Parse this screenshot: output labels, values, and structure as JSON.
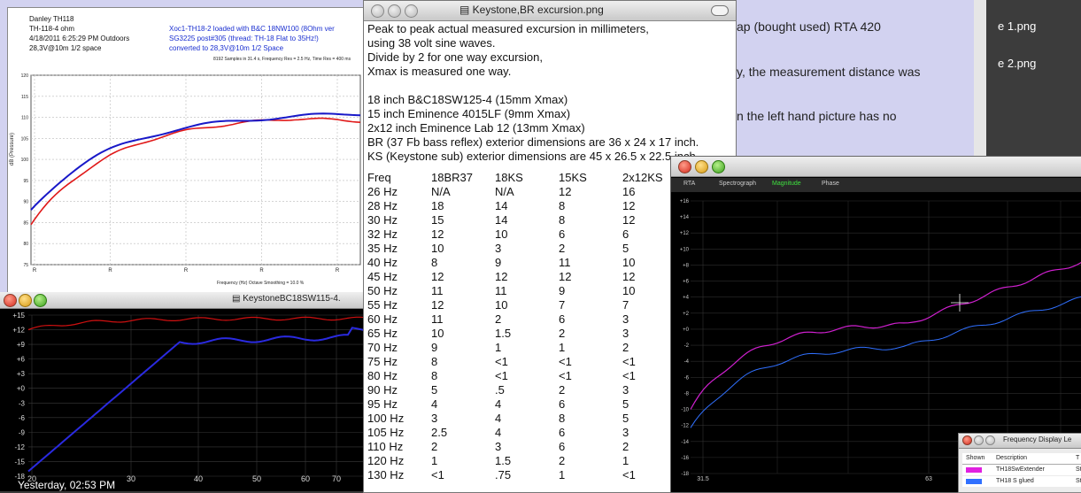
{
  "background_text": {
    "line1": "ap (bought used) RTA 420",
    "line2": "y, the measurement distance was",
    "line3": "n the left hand picture has no",
    "thumb1": "e 1.png",
    "thumb2": "e 2.png",
    "finder_date": "Yesterday, 02:53 PM"
  },
  "chart1": {
    "h_name": "Danley TH118",
    "h_model": "TH-118-4 ohm",
    "h_date": "4/18/2011 6:25:29 PM   Outdoors",
    "h_level": "28,3V@10m 1/2 space",
    "h_b1": "Xoc1-TH18-2 loaded with B&C 18NW100 (8Ohm ver",
    "h_b2": "SG3225 post#305 (thread: TH-18 Flat to 35Hz!)",
    "h_b3": "converted to 28,3V@10m  1/2 Space",
    "samples": "8192 Samples in 31.4 s, Frequency Res = 2.5 Hz, Time Res = 400 ms",
    "ylabel": "dB (Pressure)",
    "xlabel": "Frequency (Hz)   Octave Smoothing = 10.0 %",
    "y_ticks": [
      "120",
      "115",
      "110",
      "105",
      "100",
      "95",
      "90",
      "85",
      "80",
      "75"
    ],
    "x_ticks": [
      "R",
      "R",
      "R",
      "R",
      "R"
    ]
  },
  "chart2": {
    "title": "KeystoneBC18SW115-4.",
    "y_ticks": [
      "+15",
      "+12",
      "+9",
      "+6",
      "+3",
      "+0",
      "-3",
      "-6",
      "-9",
      "-12",
      "-15",
      "-18"
    ],
    "x_ticks": [
      "20",
      "30",
      "40",
      "50",
      "60",
      "70"
    ]
  },
  "doc": {
    "title": "Keystone,BR excursion.png",
    "lines": [
      "Peak to peak actual measured excursion in millimeters,",
      "using 38 volt sine waves.",
      "Divide by 2 for one way excursion,",
      "Xmax is measured one way.",
      "",
      "18 inch B&C18SW125-4 (15mm Xmax)",
      "15 inch Eminence 4015LF (9mm Xmax)",
      "2x12 inch Eminence Lab 12 (13mm Xmax)",
      "BR (37 Fb bass reflex) exterior dimensions are 36 x 24 x 17 inch.",
      "KS (Keystone sub) exterior dimensions are 45 x 26.5 x 22.5 inch"
    ],
    "headers": [
      "Freq",
      "18BR37",
      "18KS",
      "15KS",
      "2x12KS"
    ],
    "rows": [
      [
        "26 Hz",
        "N/A",
        "N/A",
        "12",
        "16"
      ],
      [
        "28 Hz",
        "18",
        "14",
        "8",
        "12"
      ],
      [
        "30 Hz",
        "15",
        "14",
        "8",
        "12"
      ],
      [
        "32 Hz",
        "12",
        "10",
        "6",
        "6"
      ],
      [
        "35 Hz",
        "10",
        "3",
        "2",
        "5"
      ],
      [
        "40 Hz",
        "8",
        "9",
        "11",
        "10"
      ],
      [
        "45 Hz",
        "12",
        "12",
        "12",
        "12"
      ],
      [
        "50 Hz",
        "11",
        "11",
        "9",
        "10"
      ],
      [
        "55 Hz",
        "12",
        "10",
        "7",
        "7"
      ],
      [
        "60 Hz",
        "11",
        "2",
        "6",
        "3"
      ],
      [
        "65 Hz",
        "10",
        "1.5",
        "2",
        "3"
      ],
      [
        "70 Hz",
        "9",
        "1",
        "1",
        "2"
      ],
      [
        "75 Hz",
        "8",
        "<1",
        "<1",
        "<1"
      ],
      [
        "80 Hz",
        "8",
        "<1",
        "<1",
        "<1"
      ],
      [
        "90 Hz",
        "5",
        ".5",
        "2",
        "3"
      ],
      [
        "95 Hz",
        "4",
        "4",
        "6",
        "5"
      ],
      [
        "100 Hz",
        "3",
        "4",
        "8",
        "5"
      ],
      [
        "105 Hz",
        "2.5",
        "4",
        "6",
        "3"
      ],
      [
        "110 Hz",
        "2",
        "3",
        "6",
        "2"
      ],
      [
        "120 Hz",
        "1",
        "1.5",
        "2",
        "1"
      ],
      [
        "130 Hz",
        "<1",
        ".75",
        "1",
        "<1"
      ]
    ]
  },
  "rta": {
    "tabs": [
      "RTA",
      "Spectrograph",
      "Magnitude",
      "Phase"
    ],
    "y_ticks": [
      "+16",
      "+14",
      "+12",
      "+10",
      "+8",
      "+6",
      "+4",
      "+2",
      "+0",
      "-2",
      "-4",
      "-6",
      "-8",
      "-10",
      "-12",
      "-14",
      "-16",
      "-18"
    ],
    "x_ticks": [
      "31.5",
      "63"
    ]
  },
  "freq_legend": {
    "title": "Frequency Display Le",
    "col_shown": "Shown",
    "col_desc": "Description",
    "col_t": "T",
    "rows": [
      {
        "desc": "TH18SwExtender",
        "t": "St",
        "color": "#e020e0"
      },
      {
        "desc": "TH18 S glued",
        "t": "St",
        "color": "#3070ff"
      }
    ]
  },
  "colors": {
    "red": "#e01818",
    "blue": "#1818c8",
    "magenta": "#d020d0",
    "rta_blue": "#3070ff"
  }
}
